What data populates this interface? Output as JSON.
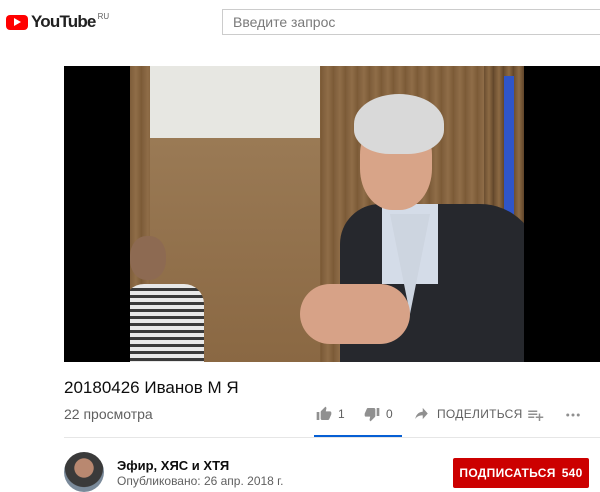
{
  "masthead": {
    "logo_text": "YouTube",
    "logo_region": "RU",
    "search_placeholder": "Введите запрос"
  },
  "video": {
    "title": "20180426 Иванов М Я",
    "views": "22 просмотра",
    "likes": "1",
    "dislikes": "0",
    "share_label": "ПОДЕЛИТЬСЯ",
    "like_ratio": 1.0
  },
  "owner": {
    "channel_name": "Эфир, ХЯС и ХТЯ",
    "published": "Опубликовано: 26 апр. 2018 г.",
    "subscribe_label": "ПОДПИСАТЬСЯ",
    "subscriber_count": "540"
  },
  "colors": {
    "brand_red": "#ff0000",
    "subscribe_red": "#cc0000",
    "accent_blue": "#065fd4"
  },
  "icons": [
    "youtube-logo-icon",
    "like-icon",
    "dislike-icon",
    "share-icon",
    "add-to-playlist-icon",
    "more-icon"
  ]
}
